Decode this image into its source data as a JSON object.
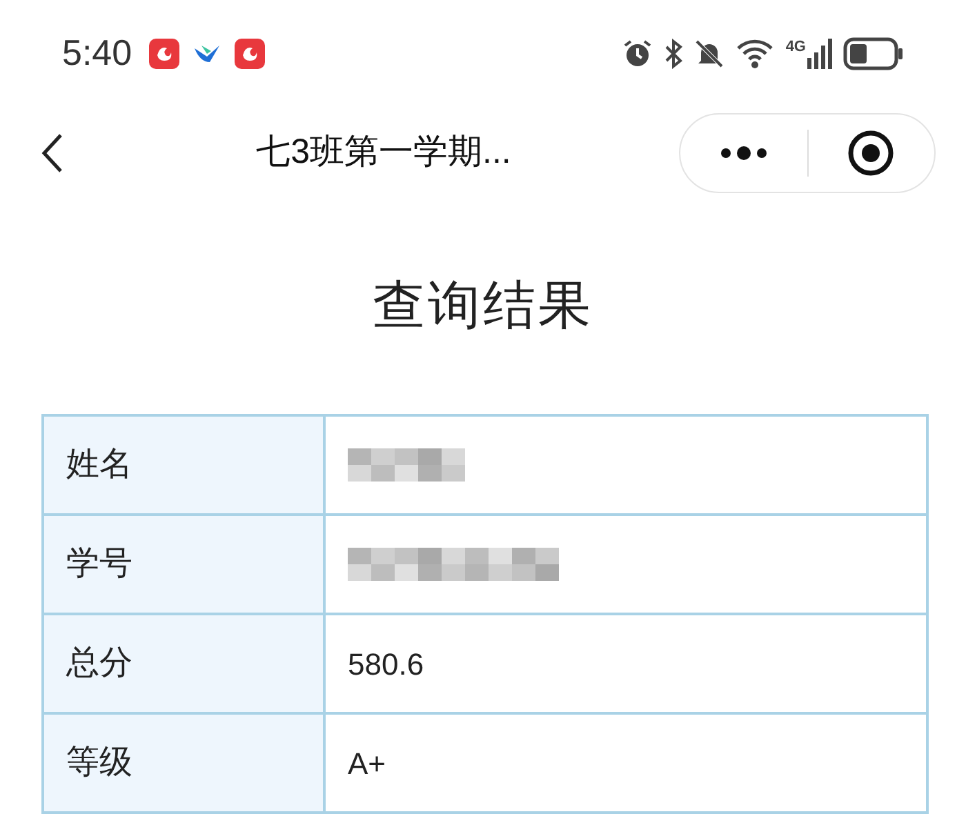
{
  "status_bar": {
    "time": "5:40",
    "network": "4G"
  },
  "nav_bar": {
    "title": "七3班第一学期..."
  },
  "heading": "查询结果",
  "table": {
    "rows": [
      {
        "label": "姓名",
        "kind": "redacted"
      },
      {
        "label": "学号",
        "kind": "redacted"
      },
      {
        "label": "总分",
        "kind": "text",
        "value": "580.6"
      },
      {
        "label": "等级",
        "kind": "text",
        "value": "A+"
      }
    ]
  }
}
